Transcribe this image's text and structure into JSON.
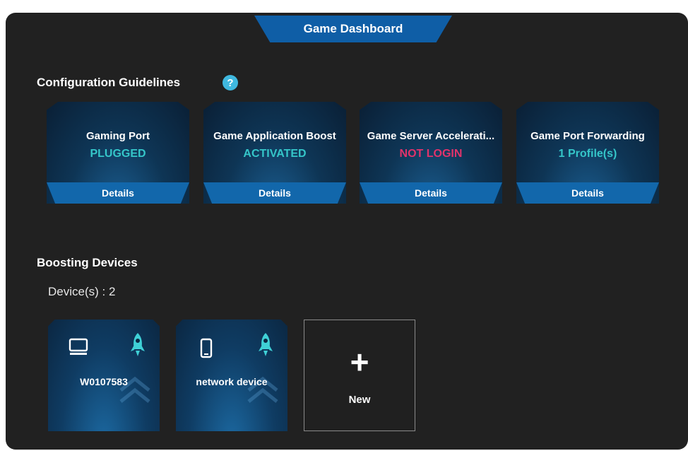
{
  "header": {
    "title": "Game Dashboard"
  },
  "config": {
    "title": "Configuration Guidelines",
    "help_icon": "?",
    "cards": [
      {
        "title": "Gaming Port",
        "status": "PLUGGED",
        "status_color": "#35c6c9",
        "details_label": "Details"
      },
      {
        "title": "Game Application Boost",
        "status": "ACTIVATED",
        "status_color": "#35c6c9",
        "details_label": "Details"
      },
      {
        "title": "Game Server Accelerati...",
        "status": "NOT LOGIN",
        "status_color": "#e0336b",
        "details_label": "Details"
      },
      {
        "title": "Game Port Forwarding",
        "status": "1 Profile(s)",
        "status_color": "#35c6c9",
        "details_label": "Details"
      }
    ]
  },
  "boosting": {
    "title": "Boosting Devices",
    "device_count": "Device(s) : 2",
    "devices": [
      {
        "name": "W0107583",
        "icon": "desktop-icon"
      },
      {
        "name": "network device",
        "icon": "phone-icon"
      }
    ],
    "new_label": "New"
  },
  "colors": {
    "background": "#212121",
    "accent_blue": "#1267ab",
    "teal": "#35c6c9",
    "alert_pink": "#e0336b"
  }
}
